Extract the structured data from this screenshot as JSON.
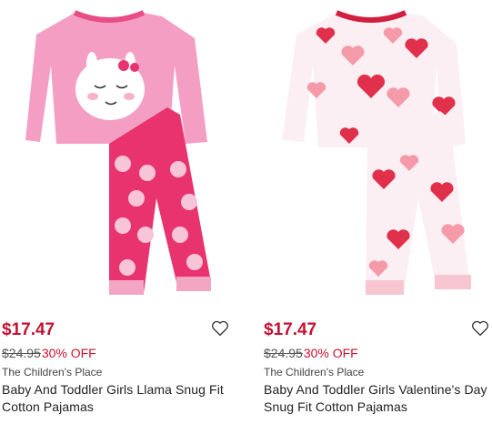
{
  "products": [
    {
      "price": "$17.47",
      "original_price": "$24.95",
      "discount": "30% OFF",
      "brand": "The Children's Place",
      "name_line1": "Baby And Toddler Girls Llama Snug Fit",
      "name_line2": "Cotton Pajamas",
      "image_icon": "llama-pajamas-image",
      "favorite_icon": "heart-outline-icon"
    },
    {
      "price": "$17.47",
      "original_price": "$24.95",
      "discount": "30% OFF",
      "brand": "The Children's Place",
      "name_line1": "Baby And Toddler Girls Valentine's Day",
      "name_line2": "Snug Fit Cotton Pajamas",
      "image_icon": "hearts-pajamas-image",
      "favorite_icon": "heart-outline-icon"
    }
  ],
  "colors": {
    "sale_red": "#c4122f",
    "pink_top": "#f59ec4",
    "pink_pants": "#e8336e"
  }
}
